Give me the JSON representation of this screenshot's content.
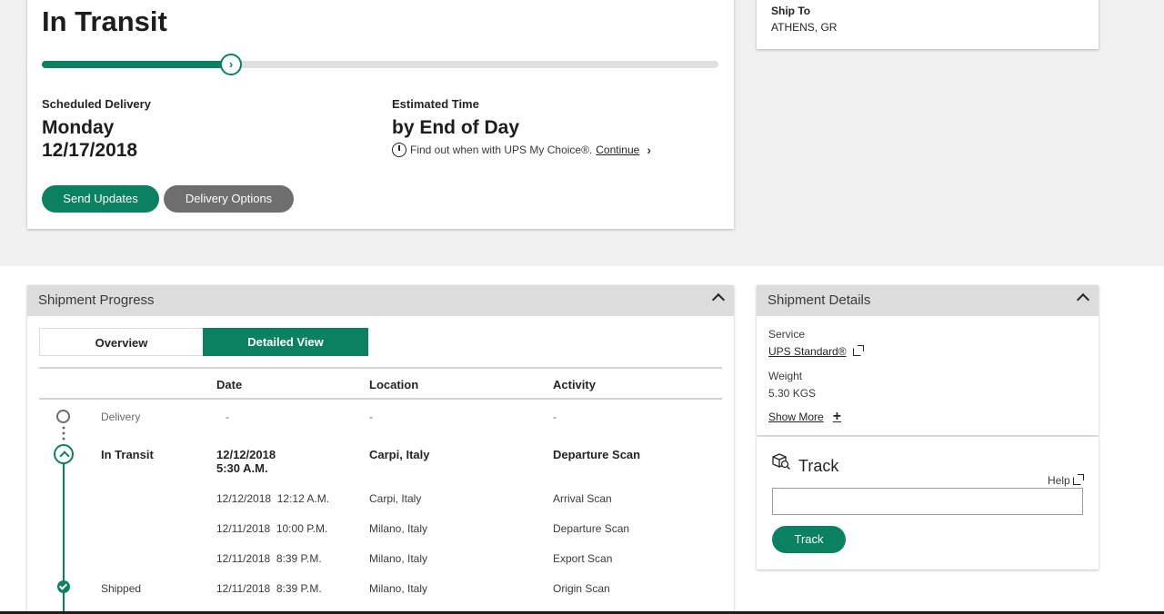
{
  "status": {
    "title": "In Transit",
    "progress_fraction": 0.28,
    "scheduled_label": "Scheduled Delivery",
    "scheduled_day": "Monday",
    "scheduled_date": "12/17/2018",
    "estimated_label": "Estimated Time",
    "estimated_value": "by End of Day",
    "mychoice_text": "Find out when with UPS My Choice®.",
    "continue_label": "Continue",
    "send_updates_label": "Send Updates",
    "delivery_options_label": "Delivery Options"
  },
  "ship_to": {
    "label": "Ship To",
    "value": "ATHENS, GR"
  },
  "progress_panel": {
    "title": "Shipment Progress",
    "tabs": {
      "overview": "Overview",
      "detailed": "Detailed View"
    },
    "columns": {
      "date": "Date",
      "location": "Location",
      "activity": "Activity"
    },
    "rows": [
      {
        "status": "Delivery",
        "date": "-",
        "location": "-",
        "activity": "-"
      },
      {
        "status": "In Transit",
        "date": "12/12/2018",
        "time": "5:30 A.M.",
        "location": "Carpi, Italy",
        "activity": "Departure Scan"
      },
      {
        "status": "",
        "date": "12/12/2018  12:12 A.M.",
        "location": "Carpi, Italy",
        "activity": "Arrival Scan"
      },
      {
        "status": "",
        "date": "12/11/2018  10:00 P.M.",
        "location": "Milano, Italy",
        "activity": "Departure Scan"
      },
      {
        "status": "",
        "date": "12/11/2018  8:39 P.M.",
        "location": "Milano, Italy",
        "activity": "Export Scan"
      },
      {
        "status": "Shipped",
        "date": "12/11/2018  8:39 P.M.",
        "location": "Milano, Italy",
        "activity": "Origin Scan"
      }
    ]
  },
  "details_panel": {
    "title": "Shipment Details",
    "service_label": "Service",
    "service_value": "UPS Standard®",
    "weight_label": "Weight",
    "weight_value": "5.30 KGS",
    "show_more_label": "Show More"
  },
  "track": {
    "title": "Track",
    "help_label": "Help",
    "input_value": "",
    "button_label": "Track"
  },
  "colors": {
    "accent": "#0a8262",
    "gray_button": "#6e6e6e",
    "panel_header": "#dcdcdc",
    "background": "#f0f0f0"
  }
}
